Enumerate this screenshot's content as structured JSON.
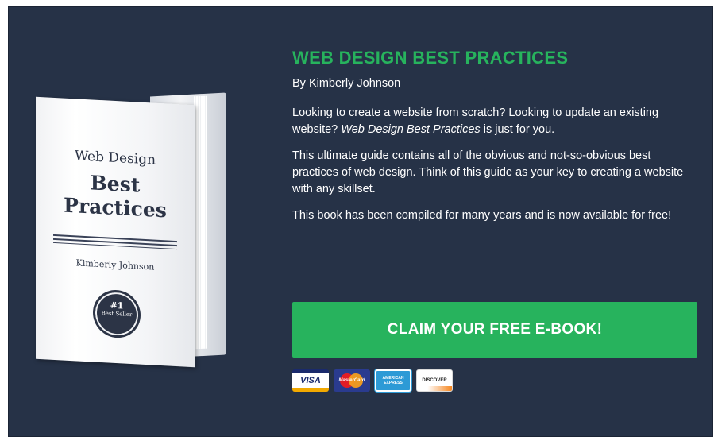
{
  "book": {
    "title_small": "Web Design",
    "title_line1": "Best",
    "title_line2": "Practices",
    "author": "Kimberly Johnson",
    "seal_number": "#1",
    "seal_text": "Best Seller"
  },
  "content": {
    "title": "WEB DESIGN BEST PRACTICES",
    "byline": "By Kimberly Johnson",
    "para1_text": "Looking to create a website from scratch? Looking to update an existing website? ",
    "para1_em": "Web Design Best Practices",
    "para1_tail": " is just for you.",
    "para2": "This ultimate guide contains all of the obvious and not-so-obvious best practices of web design. Think of this guide as your key to creating a website with any skillset.",
    "para3": "This book has been compiled for many years and is now available for free!"
  },
  "cta": {
    "label": "CLAIM YOUR FREE E-BOOK!",
    "color": "#27b35d"
  },
  "payment_cards": [
    {
      "name": "visa-card-icon",
      "label": "VISA"
    },
    {
      "name": "mastercard-card-icon",
      "label": "MasterCard"
    },
    {
      "name": "amex-card-icon",
      "label": "AMERICAN EXPRESS"
    },
    {
      "name": "discover-card-icon",
      "label": "DISCOVER"
    }
  ],
  "colors": {
    "background": "#263247",
    "accent": "#27b35d",
    "text": "#ffffff"
  }
}
